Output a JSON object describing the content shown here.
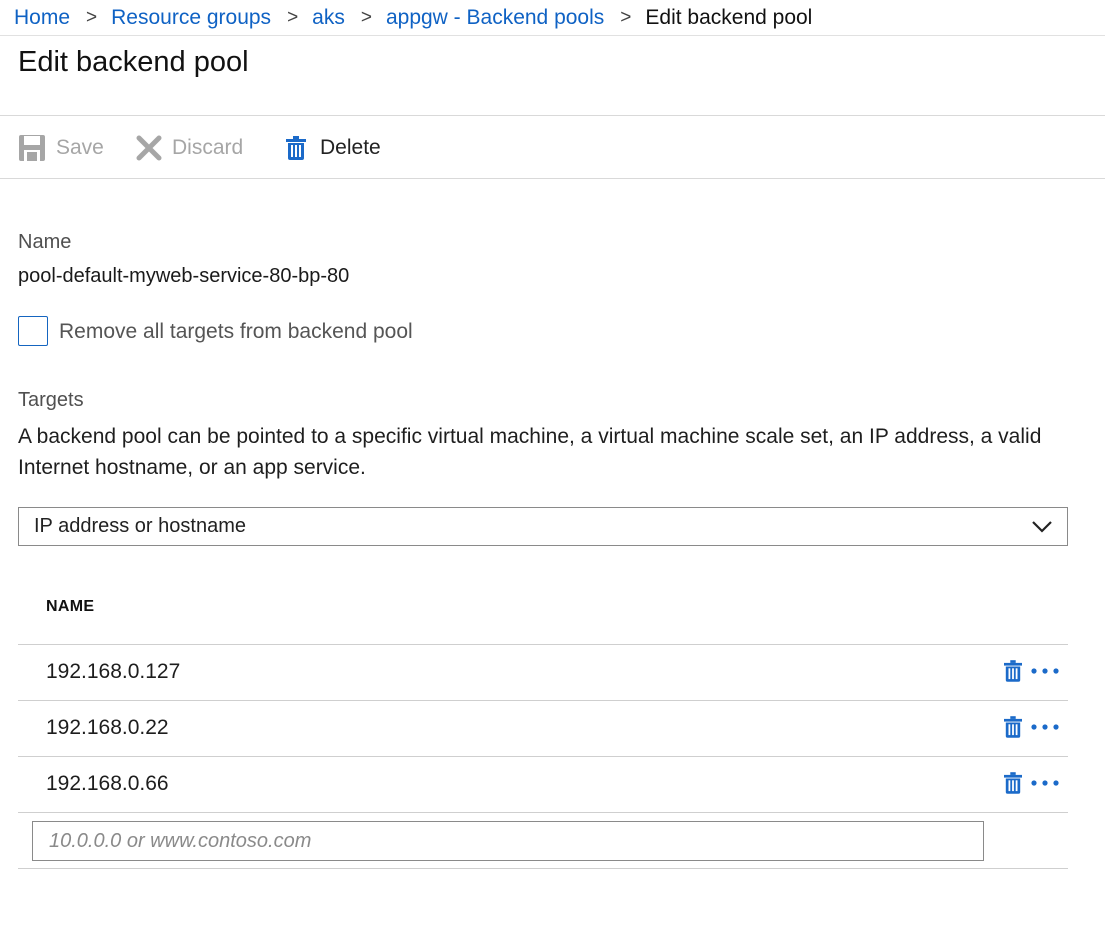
{
  "breadcrumb": {
    "items": [
      "Home",
      "Resource groups",
      "aks",
      "appgw - Backend pools"
    ],
    "current": "Edit backend pool",
    "separator": ">"
  },
  "page": {
    "title": "Edit backend pool"
  },
  "toolbar": {
    "save_label": "Save",
    "discard_label": "Discard",
    "delete_label": "Delete"
  },
  "name_field": {
    "label": "Name",
    "value": "pool-default-myweb-service-80-bp-80"
  },
  "remove_targets": {
    "label": "Remove all targets from backend pool",
    "checked": false
  },
  "targets": {
    "label": "Targets",
    "description": "A backend pool can be pointed to a specific virtual machine, a virtual machine scale set, an IP address, a valid Internet hostname, or an app service.",
    "type_selected": "IP address or hostname",
    "column_header": "NAME",
    "rows": [
      "192.168.0.127",
      "192.168.0.22",
      "192.168.0.66"
    ],
    "new_target_placeholder": "10.0.0.0 or www.contoso.com"
  },
  "colors": {
    "accent": "#0f62c4",
    "icon_blue": "#1b6ac9",
    "disabled": "#a6a6a6",
    "border": "#8a8a8a"
  },
  "icons": {
    "save": "save-icon",
    "discard": "discard-icon",
    "delete": "trash-icon",
    "more": "ellipsis-icon",
    "dropdown": "chevron-down-icon",
    "breadcrumb_sep": "chevron-right-icon"
  }
}
